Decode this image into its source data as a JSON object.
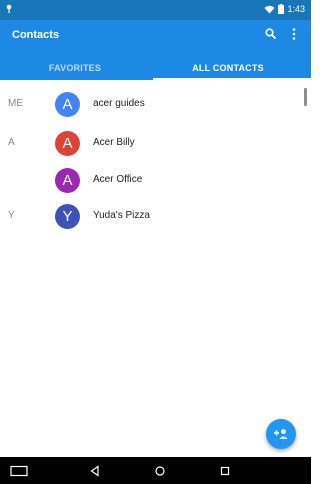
{
  "status_bar": {
    "time": "1:43"
  },
  "app_bar": {
    "title": "Contacts"
  },
  "tabs": [
    {
      "label": "FAVORITES"
    },
    {
      "label": "ALL CONTACTS"
    }
  ],
  "contacts": [
    {
      "section": "ME",
      "initial": "A",
      "name": "acer guides",
      "color": "#4285f4"
    },
    {
      "section": "A",
      "initial": "A",
      "name": "Acer Billy",
      "color": "#db4437"
    },
    {
      "section": "",
      "initial": "A",
      "name": "Acer Office",
      "color": "#9c27b0"
    },
    {
      "section": "Y",
      "initial": "Y",
      "name": "Yuda's Pizza",
      "color": "#3f51b5"
    }
  ],
  "colors": {
    "status_bar": "#1976b8",
    "app_bar": "#1e88e5",
    "fab": "#2196f3"
  },
  "icons": [
    "pin-icon",
    "wifi-icon",
    "battery-icon",
    "search-icon",
    "more-vert-icon",
    "add-contact-icon",
    "keyboard-icon",
    "back-icon",
    "home-icon",
    "recents-icon"
  ]
}
